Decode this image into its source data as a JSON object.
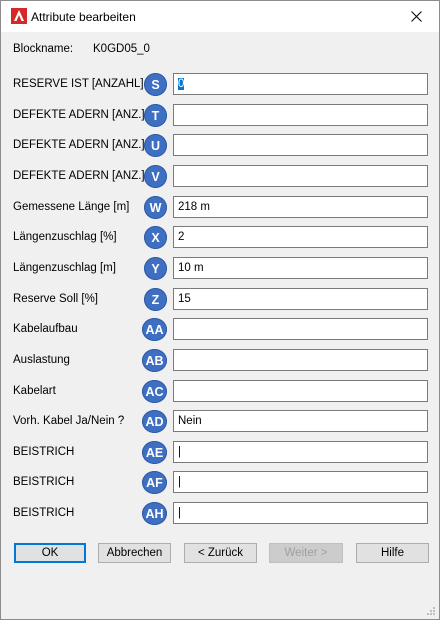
{
  "window": {
    "title": "Attribute bearbeiten",
    "app_icon": "autocad-icon",
    "accent": "#0078d7"
  },
  "block": {
    "label": "Blockname:",
    "value": "K0GD05_0"
  },
  "rows": [
    {
      "label": "RESERVE IST  [ANZAHL]",
      "badge": "S",
      "value": "0"
    },
    {
      "label": "DEFEKTE ADERN  [ANZ.]",
      "badge": "T",
      "value": ""
    },
    {
      "label": "DEFEKTE ADERN  [ANZ.]",
      "badge": "U",
      "value": ""
    },
    {
      "label": "DEFEKTE ADERN  [ANZ.]",
      "badge": "V",
      "value": ""
    },
    {
      "label": "Gemessene Länge [m]",
      "badge": "W",
      "value": "218 m"
    },
    {
      "label": "Längenzuschlag [%]",
      "badge": "X",
      "value": "2"
    },
    {
      "label": "Längenzuschlag [m]",
      "badge": "Y",
      "value": "10 m"
    },
    {
      "label": "Reserve Soll [%]",
      "badge": "Z",
      "value": "15"
    },
    {
      "label": "Kabelaufbau",
      "badge": "AA",
      "value": ""
    },
    {
      "label": "Auslastung",
      "badge": "AB",
      "value": ""
    },
    {
      "label": "Kabelart",
      "badge": "AC",
      "value": ""
    },
    {
      "label": "Vorh. Kabel Ja/Nein ?",
      "badge": "AD",
      "value": "Nein"
    },
    {
      "label": "BEISTRICH",
      "badge": "AE",
      "value": "|"
    },
    {
      "label": "BEISTRICH",
      "badge": "AF",
      "value": "|"
    },
    {
      "label": "BEISTRICH",
      "badge": "AH",
      "value": "|"
    }
  ],
  "badge_color": "#3e6fc3",
  "buttons": {
    "ok": "OK",
    "cancel": "Abbrechen",
    "back": "< Zurück",
    "next": "Weiter >",
    "help": "Hilfe"
  }
}
